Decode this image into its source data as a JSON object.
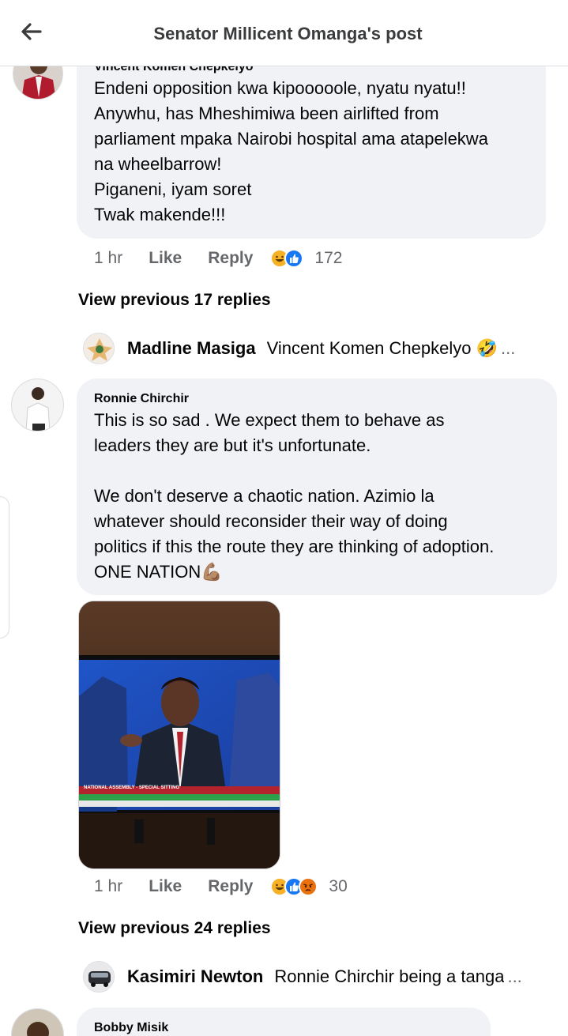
{
  "header": {
    "title": "Senator Millicent Omanga's post",
    "back_icon": "arrow-left-icon"
  },
  "comments": [
    {
      "author": "Vincent Komen Chepkelyo",
      "text": "Endeni opposition kwa kipooooole, nyatu nyatu!!\nAnywhu, has Mheshimiwa been airlifted from\nparliament mpaka Nairobi hospital ama atapelekwa\nna wheelbarrow!\nPiganeni, iyam soret\nTwak makende!!!",
      "time": "1 hr",
      "like": "Like",
      "reply": "Reply",
      "reactions": [
        "haha",
        "like"
      ],
      "reaction_count": "172",
      "view_previous": "View previous 17 replies",
      "latest_reply": {
        "name": "Madline Masiga",
        "text": "Vincent Komen Chepkelyo 🤣",
        "ellipsis": "..."
      }
    },
    {
      "author": "Ronnie Chirchir",
      "text": "This is so sad . We expect them to behave as\nleaders they are but it's unfortunate.\n\nWe don't deserve a chaotic nation. Azimio la\nwhatever should reconsider their way of doing\npolitics if this the route they are thinking of adoption.\nONE NATION💪🏽",
      "image_caption": "NATIONAL ASSEMBLY - SPECIAL SITTING",
      "time": "1 hr",
      "like": "Like",
      "reply": "Reply",
      "reactions": [
        "haha",
        "like",
        "angry"
      ],
      "reaction_count": "30",
      "view_previous": "View previous 24 replies",
      "latest_reply": {
        "name": "Kasimiri Newton",
        "text": "Ronnie Chirchir being a tanga",
        "ellipsis": "..."
      }
    },
    {
      "author": "Bobby Misik"
    }
  ],
  "colors": {
    "bubble": "#f0f2f5",
    "meta_text": "#65676b",
    "like_blue": "#1877f2",
    "haha_yellow": "#f7b125",
    "angry_orange": "#e9710f"
  }
}
